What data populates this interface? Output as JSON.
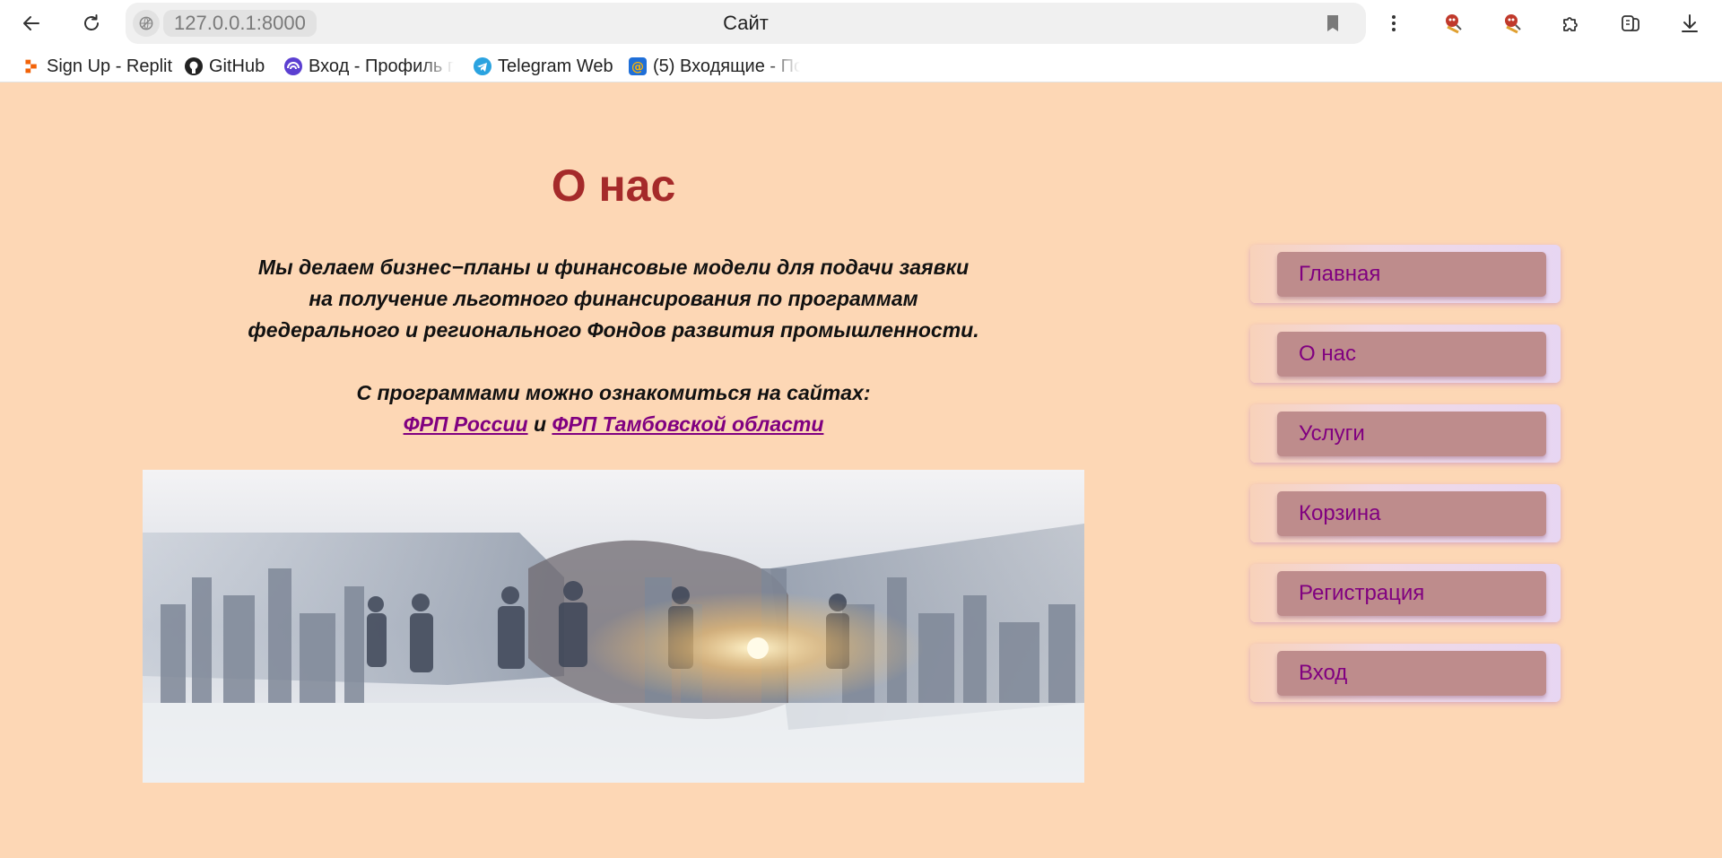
{
  "browser": {
    "url": "127.0.0.1:8000",
    "tab_title": "Сайт",
    "bookmarks": [
      {
        "label": "Sign Up - Replit",
        "icon": "replit-icon"
      },
      {
        "label": "GitHub",
        "icon": "github-icon"
      },
      {
        "label": "Вход - Профиль п",
        "icon": "profile-icon"
      },
      {
        "label": "Telegram Web",
        "icon": "telegram-icon"
      },
      {
        "label": "(5) Входящие - По",
        "icon": "mail-icon"
      }
    ]
  },
  "page": {
    "heading": "О нас",
    "intro_lines": [
      "Мы делаем бизнес−планы и финансовые модели для подачи заявки",
      "на получение льготного финансирования по программам",
      "федерального и регионального Фондов развития промышленности."
    ],
    "programs_text": "С программами можно ознакомиться на сайтах:",
    "link_russia": "ФРП России",
    "link_joiner": "и",
    "link_tambov": "ФРП Тамбовской области"
  },
  "nav": {
    "items": [
      "Главная",
      "О нас",
      "Услуги",
      "Корзина",
      "Регистрация",
      "Вход"
    ]
  },
  "colors": {
    "page_background": "#fdd7b5",
    "heading": "#a52a2a",
    "nav_button": "#be8c8c",
    "nav_text": "#800080",
    "link": "#800080"
  }
}
